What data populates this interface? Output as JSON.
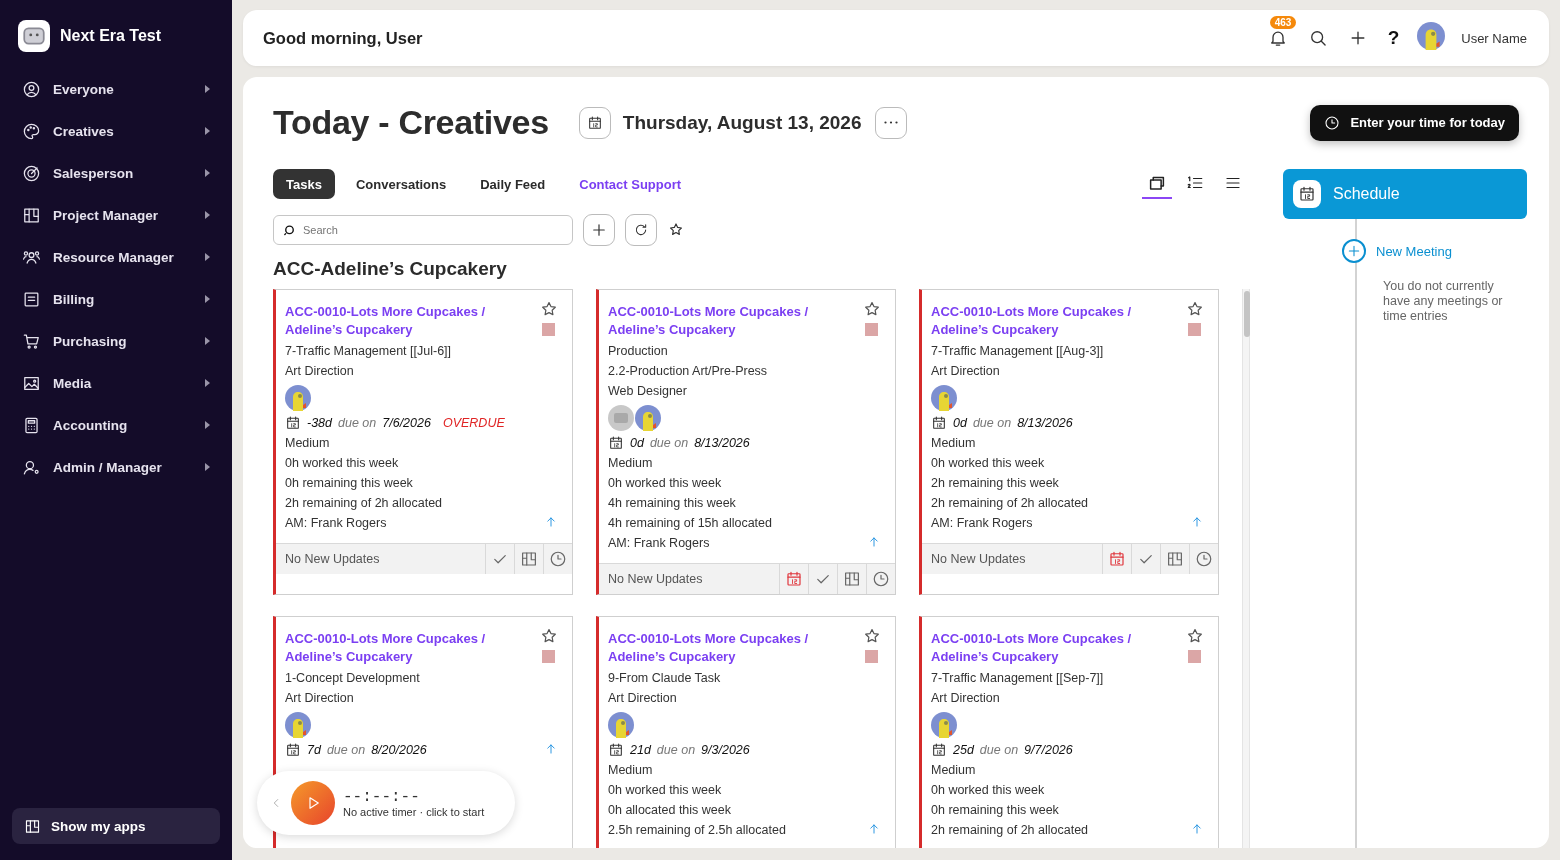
{
  "app": {
    "name": "Next Era Test"
  },
  "sidebar": {
    "items": [
      {
        "label": "Everyone"
      },
      {
        "label": "Creatives"
      },
      {
        "label": "Salesperson"
      },
      {
        "label": "Project Manager"
      },
      {
        "label": "Resource Manager"
      },
      {
        "label": "Billing"
      },
      {
        "label": "Purchasing"
      },
      {
        "label": "Media"
      },
      {
        "label": "Accounting"
      },
      {
        "label": "Admin / Manager"
      }
    ],
    "footer_button": "Show my apps"
  },
  "top_bar": {
    "greeting": "Good morning, User",
    "notification_count": "463",
    "help_label": "?",
    "user_name": "User Name"
  },
  "page": {
    "title": "Today - Creatives",
    "date": "Thursday, August 13, 2026",
    "time_button": "Enter your time for today"
  },
  "tabs": [
    {
      "label": "Tasks",
      "kind": "tab",
      "selected": true
    },
    {
      "label": "Conversations",
      "kind": "tab",
      "selected": false
    },
    {
      "label": "Daily Feed",
      "kind": "tab",
      "selected": false
    },
    {
      "label": "Contact Support",
      "kind": "link",
      "selected": false
    }
  ],
  "views": [
    {
      "kind": "cards",
      "selected": true
    },
    {
      "kind": "numbered",
      "selected": false
    },
    {
      "kind": "list",
      "selected": false
    }
  ],
  "search": {
    "placeholder": "Search"
  },
  "group": {
    "title": "ACC-Adeline’s Cupcakery"
  },
  "cards": [
    {
      "title": "ACC-0010-Lots More Cupcakes / Adeline’s Cupcakery",
      "lines": [
        "7-Traffic Management [[Jul-6]]",
        "Art Direction"
      ],
      "avatars": [
        {
          "kind": "user"
        }
      ],
      "days": "-38d",
      "due_label": "due on",
      "due_date": "7/6/2026",
      "overdue": "OVERDUE",
      "priority": "Medium",
      "stats": [
        "0h worked this week",
        "0h remaining this week",
        "2h remaining of 2h allocated",
        "AM: Frank Rogers"
      ],
      "color": "#dba6a6",
      "footer": "No New Updates",
      "calendar_flag": false
    },
    {
      "title": "ACC-0010-Lots More Cupcakes / Adeline’s Cupcakery",
      "lines": [
        "Production",
        "2.2-Production Art/Pre-Press",
        "Web Designer"
      ],
      "avatars": [
        {
          "kind": "placeholder"
        },
        {
          "kind": "user"
        }
      ],
      "days": "0d",
      "due_label": "due on",
      "due_date": "8/13/2026",
      "priority": "Medium",
      "stats": [
        "0h worked this week",
        "4h remaining this week",
        "4h remaining of 15h allocated",
        "AM: Frank Rogers"
      ],
      "color": "#dba6a6",
      "footer": "No New Updates",
      "calendar_flag": true
    },
    {
      "title": "ACC-0010-Lots More Cupcakes / Adeline’s Cupcakery",
      "lines": [
        "7-Traffic Management [[Aug-3]]",
        "Art Direction"
      ],
      "avatars": [
        {
          "kind": "user"
        }
      ],
      "days": "0d",
      "due_label": "due on",
      "due_date": "8/13/2026",
      "priority": "Medium",
      "stats": [
        "0h worked this week",
        "2h remaining this week",
        "2h remaining of 2h allocated",
        "AM: Frank Rogers"
      ],
      "color": "#dba6a6",
      "footer": "No New Updates",
      "calendar_flag": true
    },
    {
      "title": "ACC-0010-Lots More Cupcakes / Adeline’s Cupcakery",
      "lines": [
        "1-Concept Development",
        "Art Direction"
      ],
      "avatars": [
        {
          "kind": "user"
        }
      ],
      "days": "7d",
      "due_label": "due on",
      "due_date": "8/20/2026",
      "color": "#dba6a6"
    },
    {
      "title": "ACC-0010-Lots More Cupcakes / Adeline’s Cupcakery",
      "lines": [
        "9-From Claude Task",
        "Art Direction"
      ],
      "avatars": [
        {
          "kind": "user"
        }
      ],
      "days": "21d",
      "due_label": "due on",
      "due_date": "9/3/2026",
      "priority": "Medium",
      "stats": [
        "0h worked this week",
        "0h allocated this week",
        "2.5h remaining of 2.5h allocated"
      ],
      "color": "#dba6a6"
    },
    {
      "title": "ACC-0010-Lots More Cupcakes / Adeline’s Cupcakery",
      "lines": [
        "7-Traffic Management [[Sep-7]]",
        "Art Direction"
      ],
      "avatars": [
        {
          "kind": "user"
        }
      ],
      "days": "25d",
      "due_label": "due on",
      "due_date": "9/7/2026",
      "priority": "Medium",
      "stats": [
        "0h worked this week",
        "0h remaining this week",
        "2h remaining of 2h allocated"
      ],
      "color": "#dba6a6"
    }
  ],
  "schedule": {
    "title": "Schedule",
    "new_meeting": "New Meeting",
    "empty_text": "You do not currently have any meetings or time entries"
  },
  "timer": {
    "display": "--:--:--",
    "hint": "No active timer · click to start"
  }
}
